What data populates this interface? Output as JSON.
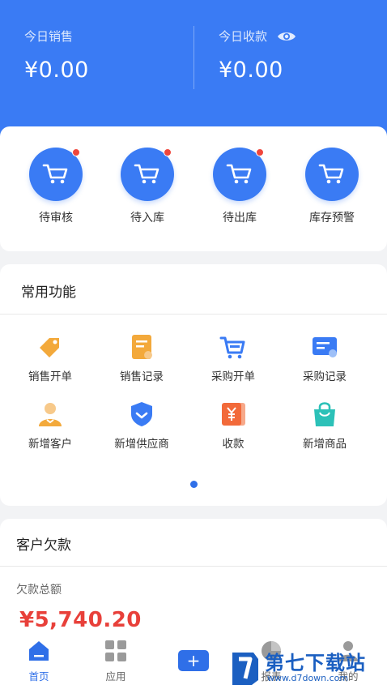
{
  "summary": {
    "today_sales_label": "今日销售",
    "today_sales_value": "¥0.00",
    "today_receipts_label": "今日收款",
    "today_receipts_value": "¥0.00"
  },
  "orders": [
    {
      "label": "待审核",
      "badge": true
    },
    {
      "label": "待入库",
      "badge": true
    },
    {
      "label": "待出库",
      "badge": true
    },
    {
      "label": "库存预警",
      "badge": false
    }
  ],
  "common_functions": {
    "title": "常用功能",
    "items": [
      {
        "label": "销售开单",
        "icon": "sales-order-icon"
      },
      {
        "label": "销售记录",
        "icon": "sales-record-icon"
      },
      {
        "label": "采购开单",
        "icon": "purchase-cart-icon"
      },
      {
        "label": "采购记录",
        "icon": "purchase-record-icon"
      },
      {
        "label": "新增客户",
        "icon": "add-customer-icon"
      },
      {
        "label": "新增供应商",
        "icon": "add-supplier-icon"
      },
      {
        "label": "收款",
        "icon": "yuan-receipt-icon"
      },
      {
        "label": "新增商品",
        "icon": "shopping-bag-icon"
      }
    ],
    "page_count": 1,
    "active_page": 1
  },
  "customer_debt": {
    "title": "客户欠款",
    "total_label": "欠款总额",
    "total_value": "¥5,740.20"
  },
  "tabbar": {
    "items": [
      {
        "label": "首页",
        "icon": "home-icon",
        "active": true
      },
      {
        "label": "应用",
        "icon": "apps-grid-icon",
        "active": false
      },
      {
        "label": "",
        "icon": "add-icon",
        "active": false
      },
      {
        "label": "报表",
        "icon": "pie-chart-icon",
        "active": false
      },
      {
        "label": "我的",
        "icon": "user-icon",
        "active": false
      }
    ],
    "add_symbol": "+"
  },
  "watermark": {
    "text": "第七下载站",
    "url": "www.d7down.com"
  },
  "colors": {
    "primary": "#3a7bf4",
    "badge": "#f0463c",
    "debt_amount": "#e8403a",
    "orange": "#f3a93b",
    "teal": "#2cc1b8",
    "orange_red": "#f26a3a"
  }
}
